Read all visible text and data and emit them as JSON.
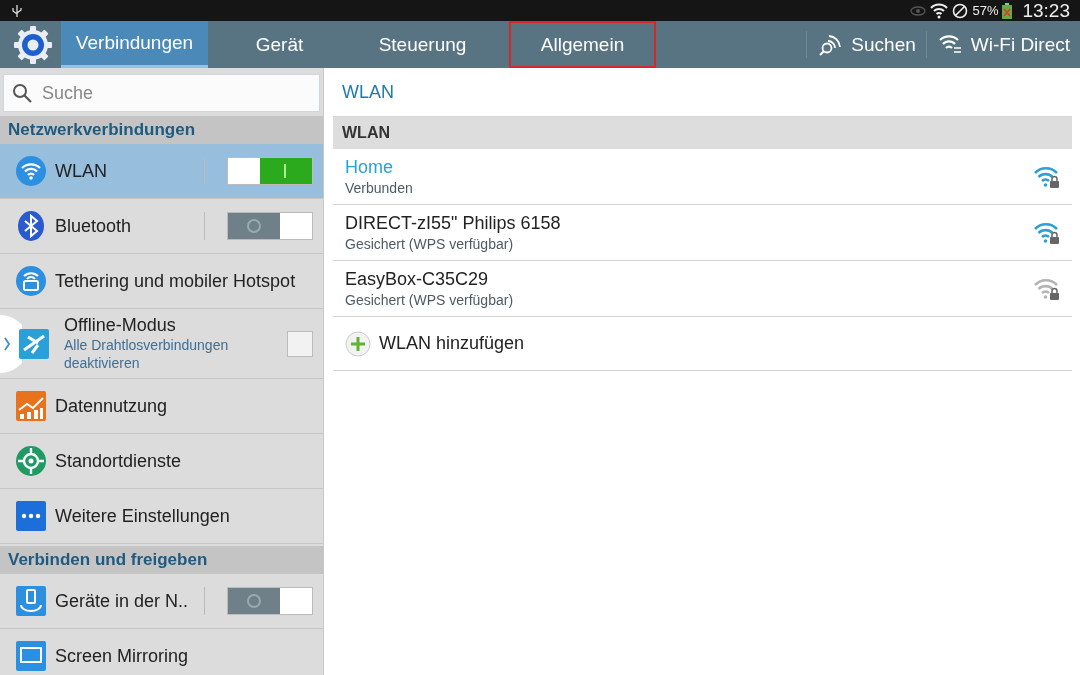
{
  "status_bar": {
    "battery": "57%",
    "time": "13:23"
  },
  "action_bar": {
    "tabs": [
      {
        "label": "Verbindungen",
        "selected": true,
        "outlined": false
      },
      {
        "label": "Gerät",
        "selected": false,
        "outlined": false
      },
      {
        "label": "Steuerung",
        "selected": false,
        "outlined": false
      },
      {
        "label": "Allgemein",
        "selected": false,
        "outlined": true
      }
    ],
    "actions": [
      "Suchen",
      "Wi-Fi Direct"
    ]
  },
  "sidebar": {
    "search": {
      "placeholder": "Suche"
    },
    "items": [
      {
        "kind": "header",
        "label": "Netzwerkverbindungen"
      },
      {
        "kind": "toggle",
        "label": "WLAN",
        "on": true,
        "selected": true
      },
      {
        "kind": "toggle",
        "label": "Bluetooth",
        "on": false,
        "selected": false
      },
      {
        "kind": "plain",
        "label": "Tethering und mobiler Hotspot",
        "selected": false
      },
      {
        "kind": "checkbox",
        "label": "Offline-Modus",
        "subtitle": "Alle Drahtlosverbindungen deaktivieren",
        "checked": false,
        "selected": false
      },
      {
        "kind": "plain",
        "label": "Datennutzung",
        "selected": false
      },
      {
        "kind": "plain",
        "label": "Standortdienste",
        "selected": false
      },
      {
        "kind": "plain",
        "label": "Weitere Einstellungen",
        "selected": false
      },
      {
        "kind": "header",
        "label": "Verbinden und freigeben"
      },
      {
        "kind": "toggle",
        "label": "Geräte in der N..",
        "on": false,
        "selected": false
      },
      {
        "kind": "plain",
        "label": "Screen Mirroring",
        "selected": false
      }
    ]
  },
  "content": {
    "title": "WLAN",
    "section": "WLAN",
    "networks": [
      {
        "name": "Home",
        "status": "Verbunden",
        "connected": true,
        "color": "#2aa0d8"
      },
      {
        "name": "DIRECT-zI55\" Philips 6158",
        "status": "Gesichert (WPS verfügbar)",
        "connected": false,
        "color": "#2aa0d8"
      },
      {
        "name": "EasyBox-C35C29",
        "status": "Gesichert (WPS verfügbar)",
        "connected": false,
        "color": "#b4b4b4"
      }
    ],
    "add_label": "WLAN hinzufügen"
  }
}
